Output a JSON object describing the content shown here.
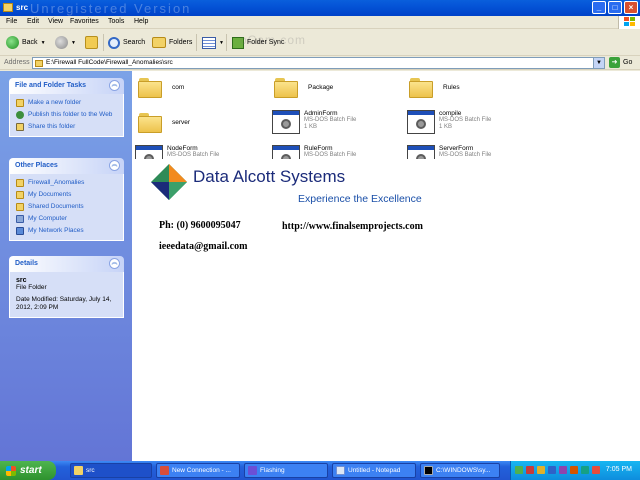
{
  "window": {
    "title": "src",
    "watermark": "Unregistered Version",
    "watermark2": "oCam.com"
  },
  "menubar": {
    "items": [
      "File",
      "Edit",
      "View",
      "Favorites",
      "Tools",
      "Help"
    ]
  },
  "toolbar": {
    "back": "Back",
    "search": "Search",
    "folders": "Folders",
    "folder_sync": "Folder Sync"
  },
  "address": {
    "label": "Address",
    "value": "E:\\Firewall FullCode\\Firewall_Anomalies\\src",
    "go": "Go"
  },
  "tasks": {
    "file_folder": {
      "title": "File and Folder Tasks",
      "links": [
        "Make a new folder",
        "Publish this folder to the Web",
        "Share this folder"
      ]
    },
    "other_places": {
      "title": "Other Places",
      "links": [
        "Firewall_Anomalies",
        "My Documents",
        "Shared Documents",
        "My Computer",
        "My Network Places"
      ]
    },
    "details": {
      "title": "Details",
      "name": "src",
      "type": "File Folder",
      "modified": "Date Modified: Saturday, July 14, 2012, 2:09 PM"
    }
  },
  "files": {
    "com": {
      "name": "com"
    },
    "package": {
      "name": "Package"
    },
    "rules": {
      "name": "Rules"
    },
    "server": {
      "name": "server"
    },
    "adminform": {
      "name": "AdminForm",
      "type": "MS-DOS Batch File",
      "size": "1 KB"
    },
    "compile": {
      "name": "compile",
      "type": "MS-DOS Batch File",
      "size": "1 KB"
    },
    "nodeform": {
      "name": "NodeForm",
      "type": "MS-DOS Batch File"
    },
    "ruleform": {
      "name": "RuleForm",
      "type": "MS-DOS Batch File"
    },
    "serverform": {
      "name": "ServerForm",
      "type": "MS-DOS Batch File"
    }
  },
  "overlay": {
    "brand": "Data Alcott Systems",
    "tagline": "Experience the Excellence",
    "phone": "Ph: (0) 9600095047",
    "url": "http://www.finalsemprojects.com",
    "email": "ieeedata@gmail.com"
  },
  "taskbar": {
    "start": "start",
    "tasks": [
      "src",
      "New Connection - ...",
      "Flashing",
      "Untitled - Notepad",
      "C:\\WINDOWS\\sy..."
    ],
    "clock": "7:05 PM"
  },
  "colors": {
    "xp_blue": "#0453D6",
    "taskpane_link": "#215DC6",
    "brand_navy": "#1B2B7A",
    "logo_green": "#2E8B57",
    "logo_orange": "#F28A1E"
  }
}
